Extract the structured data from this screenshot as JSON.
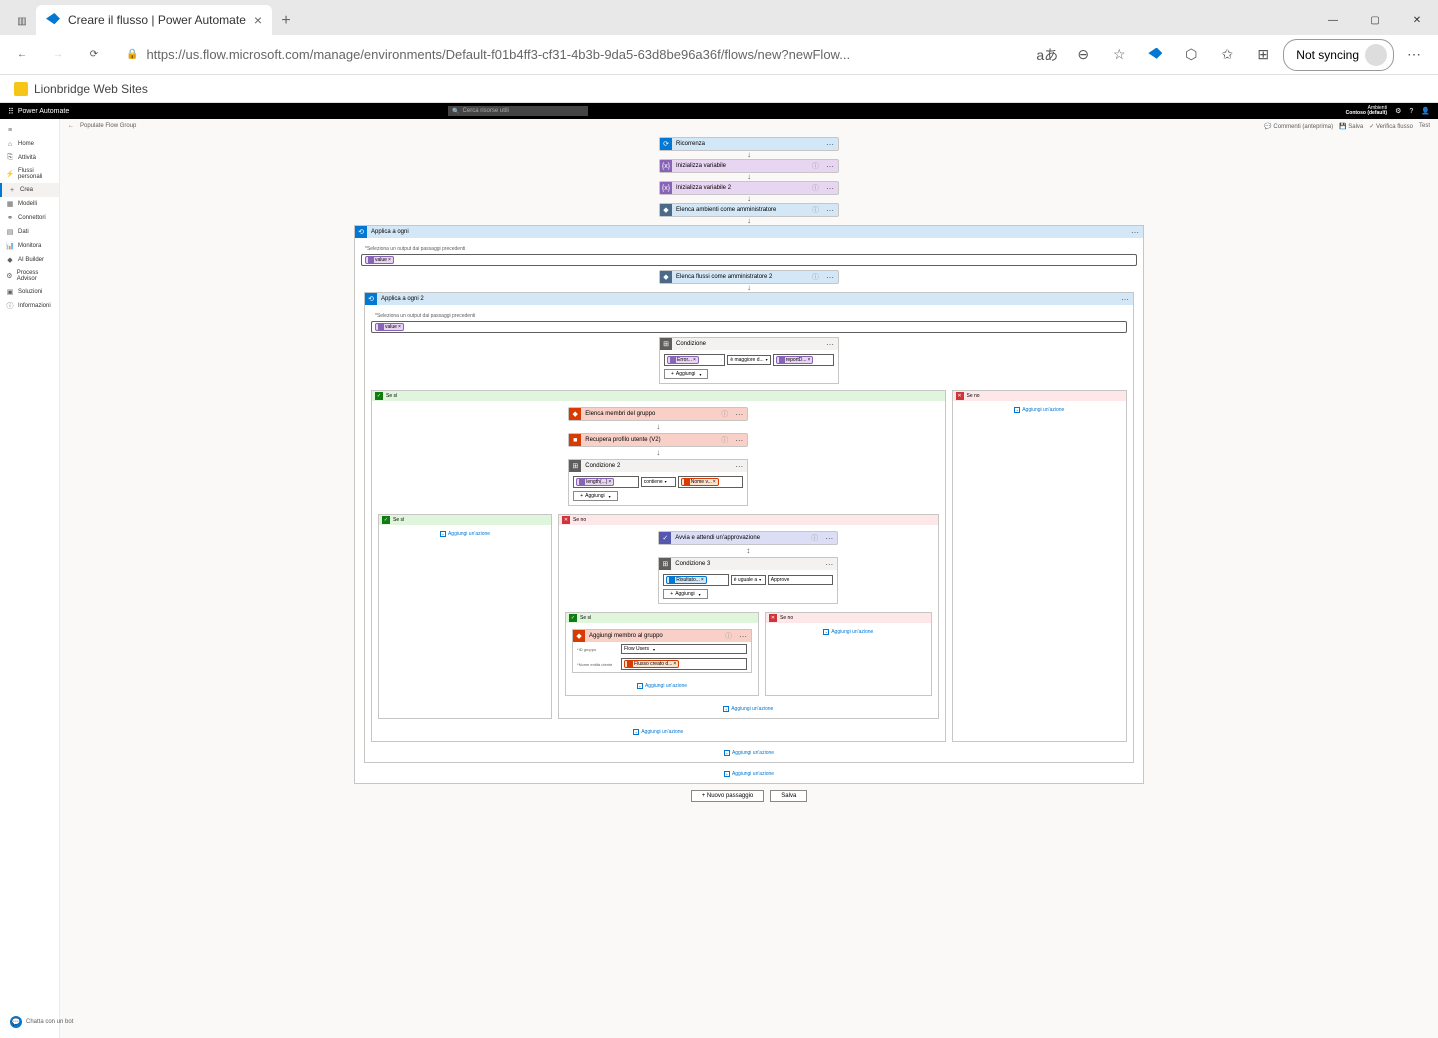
{
  "browser": {
    "tab_title": "Creare il flusso | Power Automate",
    "url": "https://us.flow.microsoft.com/manage/environments/Default-f01b4ff3-cf31-4b3b-9da5-63d8be96a36f/flows/new?newFlow...",
    "not_syncing": "Not syncing",
    "fav_label": "Lionbridge Web Sites"
  },
  "header": {
    "app_name": "Power Automate",
    "search_placeholder": "Cerca risorse utili",
    "env_label": "Ambienti",
    "env_name": "Contoso (default)"
  },
  "sidebar": {
    "items": [
      "Home",
      "Attività",
      "Flussi personali",
      "Crea",
      "Modelli",
      "Connettori",
      "Dati",
      "Monitora",
      "AI Builder",
      "Process Advisor",
      "Soluzioni",
      "Informazioni"
    ],
    "active_index": 3
  },
  "topbar": {
    "back": "←",
    "flow_name": "Populate Flow Group",
    "commenti": "Commenti (anteprima)",
    "salva": "Salva",
    "verifica": "Verifica flusso",
    "test": "Test"
  },
  "flow": {
    "trigger": "Ricorrenza",
    "init1": "Inizializza variabile",
    "init2": "Inizializza variabile 2",
    "list_env": "Elenca ambienti come amministratore",
    "loop1": {
      "title": "Applica a ogni",
      "select_label": "*Seleziona un output dai passaggi precedenti",
      "token": "value",
      "list_flows": "Elenca flussi come amministratore 2"
    },
    "loop2": {
      "title": "Applica a ogni 2",
      "select_label": "*Seleziona un output dai passaggi precedenti",
      "token": "value"
    },
    "condition": {
      "title": "Condizione",
      "left": "Error...",
      "op": "è maggiore d...",
      "right": "reportD...",
      "add": "Aggiungi"
    },
    "yes_label": "Se sì",
    "no_label": "Se no",
    "list_members": "Elenca membri del gruppo",
    "get_profile": "Recupera profilo utente (V2)",
    "condition2": {
      "title": "Condizione 2",
      "left": "length(...)",
      "op": "contiene",
      "right": "Nome v...",
      "add": "Aggiungi"
    },
    "approval": "Avvia e attendi un'approvazione",
    "condition3": {
      "title": "Condizione 3",
      "left": "Risultato...",
      "op": "è uguale a",
      "right": "Approve",
      "add": "Aggiungi"
    },
    "add_member": {
      "title": "Aggiungi membro al gruppo",
      "group_label": "*ID gruppo",
      "group_value": "Flow Users",
      "user_label": "*Nome entità utente",
      "user_token": "Flusso creato d..."
    },
    "add_action": "Aggiungi un'azione",
    "new_step": "+ Nuovo passaggio",
    "save": "Salva"
  },
  "chat": "Chatta con un bot"
}
